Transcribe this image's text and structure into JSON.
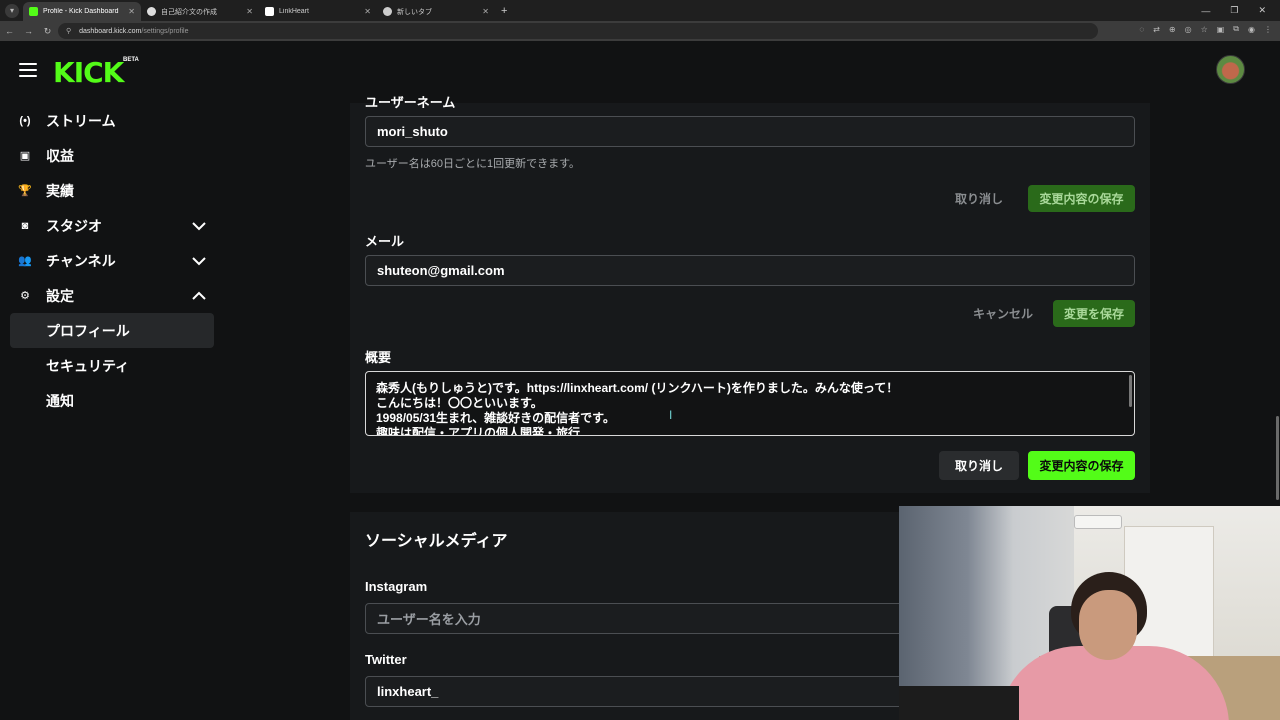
{
  "browser": {
    "tabs": [
      {
        "title": "Profile - Kick Dashboard",
        "active": true,
        "favicon_color": "#53fc18"
      },
      {
        "title": "自己紹介文の作成",
        "active": false,
        "favicon_color": "#dddddd"
      },
      {
        "title": "LinkHeart",
        "active": false,
        "favicon_color": "#ffffff"
      },
      {
        "title": "新しいタブ",
        "active": false,
        "favicon_color": "#cccccc"
      }
    ],
    "url_host": "dashboard.kick.com",
    "url_path": "/settings/profile"
  },
  "header": {
    "logo": "KICK",
    "beta": "BETA"
  },
  "sidebar": {
    "items": [
      {
        "label": "ストリーム",
        "icon": "stream-icon",
        "glyph": "(•)"
      },
      {
        "label": "収益",
        "icon": "revenue-icon",
        "glyph": "▣"
      },
      {
        "label": "実績",
        "icon": "trophy-icon",
        "glyph": "🏆"
      },
      {
        "label": "スタジオ",
        "icon": "studio-icon",
        "glyph": "◙",
        "expandable": true
      },
      {
        "label": "チャンネル",
        "icon": "channel-icon",
        "glyph": "👥",
        "expandable": true
      },
      {
        "label": "設定",
        "icon": "gear-icon",
        "glyph": "⚙",
        "expandable": true,
        "expanded": true
      }
    ],
    "sub_items": [
      {
        "label": "プロフィール",
        "active": true
      },
      {
        "label": "セキュリティ",
        "active": false
      },
      {
        "label": "通知",
        "active": false
      }
    ]
  },
  "profile": {
    "username": {
      "label": "ユーザーネーム",
      "value": "mori_shuto",
      "hint": "ユーザー名は60日ごとに1回更新できます。",
      "cancel": "取り消し",
      "save": "変更内容の保存"
    },
    "email": {
      "label": "メール",
      "value": "shuteon@gmail.com",
      "cancel": "キャンセル",
      "save": "変更を保存"
    },
    "bio": {
      "label": "概要",
      "lines": [
        "森秀人(もりしゅうと)です。https://linxheart.com/ (リンクハート)を作りました。みんな使って！",
        "こんにちは！〇〇といいます。",
        "1998/05/31生まれ、雑談好きの配信者です。",
        "趣味は配信・アプリの個人開発・旅行"
      ],
      "cancel": "取り消し",
      "save": "変更内容の保存"
    }
  },
  "social": {
    "title": "ソーシャルメディア",
    "instagram": {
      "label": "Instagram",
      "placeholder": "ユーザー名を入力"
    },
    "twitter": {
      "label": "Twitter",
      "value": "linxheart_"
    }
  },
  "colors": {
    "accent": "#53fc18",
    "background": "#111213",
    "panel": "#17191b"
  }
}
